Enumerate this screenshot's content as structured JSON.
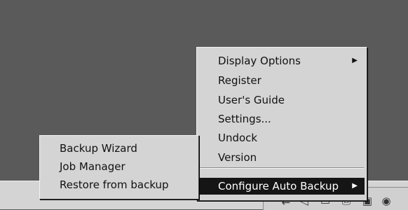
{
  "tray_menu": {
    "items": [
      {
        "label": "Display Options",
        "submenu_arrow": "▶"
      },
      {
        "label": "Register"
      },
      {
        "label": "User's Guide"
      },
      {
        "label": "Settings..."
      },
      {
        "label": "Undock"
      },
      {
        "label": "Version"
      }
    ],
    "selected_item": {
      "label": "Configure Auto Backup",
      "submenu_arrow": "▶"
    }
  },
  "submenu": {
    "items": [
      {
        "label": "Backup Wizard"
      },
      {
        "label": "Job Manager"
      },
      {
        "label": "Restore from backup"
      }
    ]
  },
  "tray": {
    "icons": [
      "network-icon",
      "speaker-icon",
      "display-icon",
      "printer-icon",
      "drive-icon",
      "app-icon"
    ]
  },
  "colors": {
    "desktop": "#5a5a5a",
    "menu": "#d4d4d4",
    "highlight": "#151515"
  }
}
